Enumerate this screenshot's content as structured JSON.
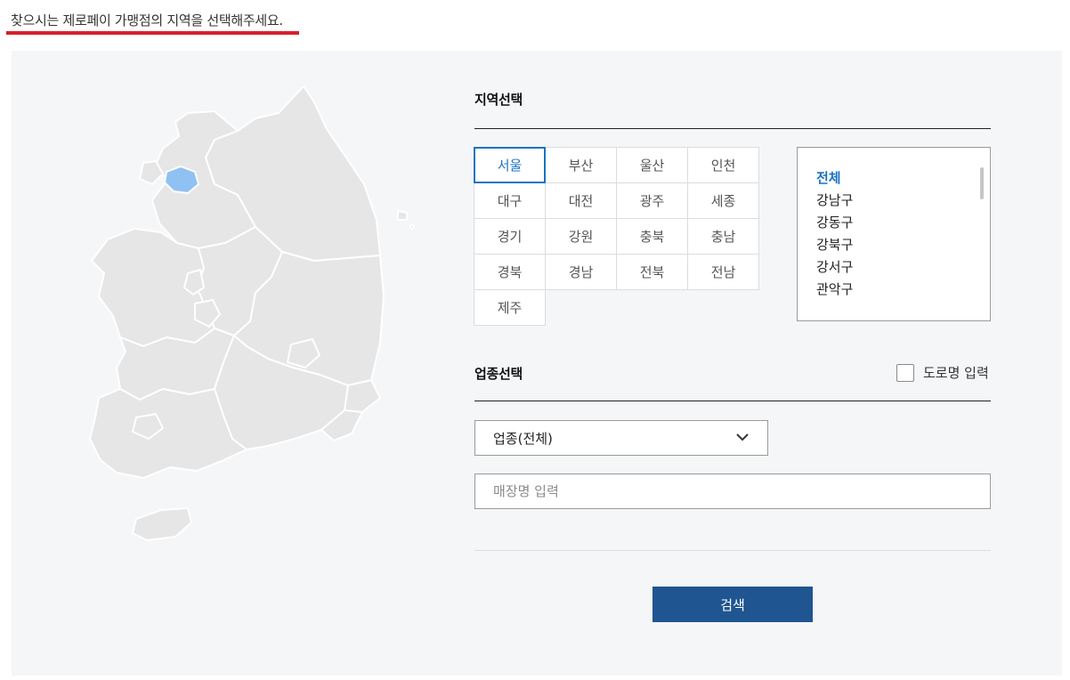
{
  "headline": "찾으시는 제로페이 가맹점의 지역을 선택해주세요.",
  "colors": {
    "accent": "#1a73c1",
    "underline": "#d8202a",
    "button": "#1f5590",
    "map_land": "#e6e6e6",
    "map_selected": "#8fc1f2"
  },
  "region_section": {
    "title": "지역선택",
    "regions": [
      "서울",
      "부산",
      "울산",
      "인천",
      "대구",
      "대전",
      "광주",
      "세종",
      "경기",
      "강원",
      "충북",
      "충남",
      "경북",
      "경남",
      "전북",
      "전남",
      "제주"
    ],
    "selected_region": "서울",
    "districts": [
      "전체",
      "강남구",
      "강동구",
      "강북구",
      "강서구",
      "관악구"
    ],
    "selected_district": "전체"
  },
  "category_section": {
    "title": "업종선택",
    "road_checkbox_label": "도로명 입력",
    "road_checked": false,
    "category_value": "업종(전체)",
    "store_placeholder": "매장명 입력"
  },
  "search_label": "검색",
  "icons": {
    "dropdown": "chevron-down-icon"
  }
}
